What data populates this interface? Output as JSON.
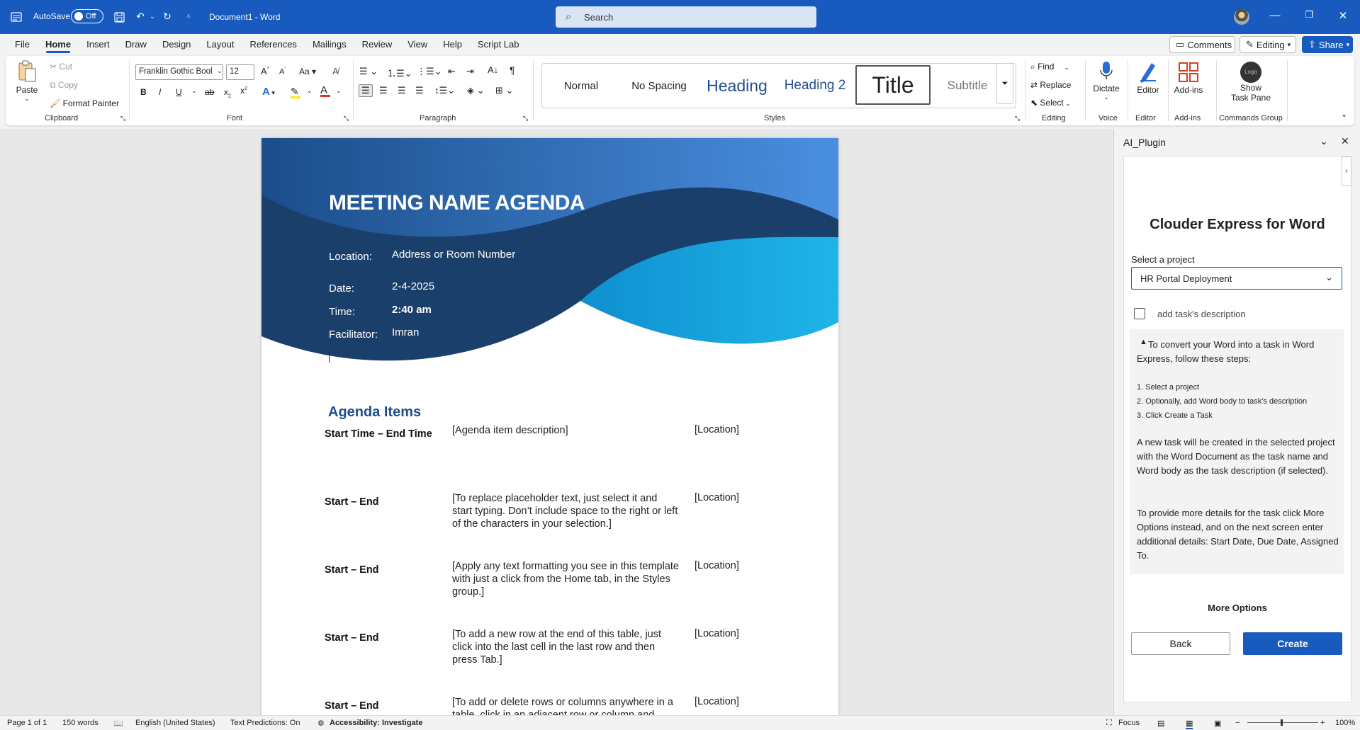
{
  "titlebar": {
    "autosave_label": "AutoSave",
    "autosave_state": "Off",
    "doc_title": "Document1  -  Word",
    "search_placeholder": "Search"
  },
  "menu": {
    "tabs": [
      "File",
      "Home",
      "Insert",
      "Draw",
      "Design",
      "Layout",
      "References",
      "Mailings",
      "Review",
      "View",
      "Help",
      "Script Lab"
    ],
    "active_tab": "Home",
    "comments_label": "Comments",
    "editing_label": "Editing",
    "share_label": "Share"
  },
  "ribbon": {
    "clipboard": {
      "paste": "Paste",
      "cut": "Cut",
      "copy": "Copy",
      "format_painter": "Format Painter",
      "label": "Clipboard"
    },
    "font": {
      "font_name": "Franklin Gothic Bool",
      "font_size": "12",
      "label": "Font"
    },
    "paragraph": {
      "label": "Paragraph"
    },
    "styles": {
      "items": [
        "Normal",
        "No Spacing",
        "Heading",
        "Heading 2",
        "Title",
        "Subtitle"
      ],
      "label": "Styles"
    },
    "editing": {
      "find": "Find",
      "replace": "Replace",
      "select": "Select",
      "label": "Editing"
    },
    "voice": {
      "dictate": "Dictate",
      "label": "Voice"
    },
    "editor": {
      "button": "Editor",
      "label": "Editor"
    },
    "addins": {
      "button": "Add-ins",
      "label": "Add-ins"
    },
    "commands": {
      "show": "Show",
      "task_pane": "Task Pane",
      "logo": "Logo",
      "label": "Commands Group"
    }
  },
  "document": {
    "title": "MEETING NAME AGENDA",
    "fields": [
      {
        "label": "Location:",
        "value": "Address or Room Number"
      },
      {
        "label": "Date:",
        "value": "2-4-2025"
      },
      {
        "label": "Time:",
        "value": "2:40 am"
      },
      {
        "label": "Facilitator:",
        "value": "Imran"
      }
    ],
    "agenda_heading": "Agenda Items",
    "rows": [
      {
        "time": "Start Time – End Time",
        "desc": "[Agenda item description]",
        "loc": "[Location]"
      },
      {
        "time": "Start – End",
        "desc": "[To replace placeholder text, just select it and start typing. Don’t include space to the right or left of the characters in your selection.]",
        "loc": "[Location]"
      },
      {
        "time": "Start – End",
        "desc": "[Apply any text formatting you see in this template with just a click from the Home tab, in the Styles group.]",
        "loc": "[Location]"
      },
      {
        "time": "Start – End",
        "desc": "[To add a new row at the end of this table, just click into the last cell in the last row and then press Tab.]",
        "loc": "[Location]"
      },
      {
        "time": "Start – End",
        "desc": "[To add or delete rows or columns anywhere in a table, click in an adjacent row or column and",
        "loc": "[Location]"
      }
    ],
    "colors": {
      "dark_blue": "#1b3f6b",
      "mid_blue": "#2f6fc0",
      "cyan": "#1aa3d9",
      "heading_blue": "#1f4e8c"
    }
  },
  "pane": {
    "title": "AI_Plugin",
    "app_title": "Clouder Express for Word",
    "select_label": "Select a project",
    "selected_project": "HR Portal Deployment",
    "checkbox_label": "add task's description",
    "info_intro": "To convert your Word into a task in Word Express, follow these steps:",
    "steps": [
      "1. Select a project",
      "2. Optionally, add Word body to task's description",
      "3. Click Create a Task"
    ],
    "para1": "A new task will be created in the selected project with the Word Document as the task name and Word body as the task description (if selected).",
    "para2": "To provide more details for the task click More Options instead, and on the next screen enter additional details: Start Date, Due Date, Assigned To.",
    "more_options": "More Options",
    "back": "Back",
    "create": "Create"
  },
  "status": {
    "page": "Page 1 of 1",
    "words": "150 words",
    "language": "English (United States)",
    "predictions": "Text Predictions: On",
    "accessibility": "Accessibility: Investigate",
    "focus": "Focus",
    "zoom": "100%"
  }
}
